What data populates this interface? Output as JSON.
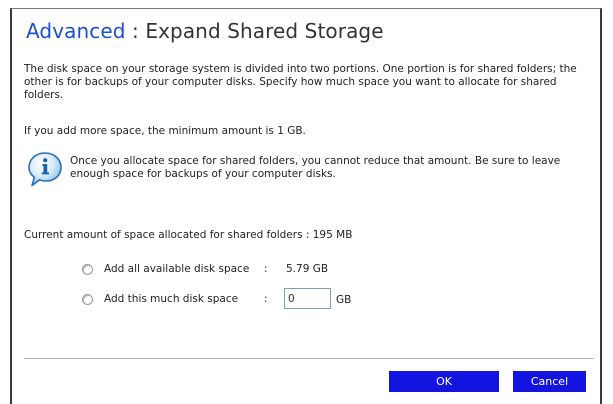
{
  "dialog": {
    "title_section": "Advanced",
    "title_separator": " : ",
    "title_page": "Expand Shared Storage",
    "intro_text": "The disk space on your storage system is divided into two portions. One portion is for shared folders; the other is for backups of your computer disks. Specify how much space you want to allocate for shared folders.",
    "minimum_text": "If you add more space, the minimum amount is 1 GB.",
    "info_icon": "info-speech-bubble-icon",
    "info_text": "Once you allocate space for shared folders, you cannot reduce that amount. Be sure to leave enough space for backups of your computer disks.",
    "current_text": "Current amount of space allocated for shared folders : 195 MB"
  },
  "options": {
    "add_all": {
      "label": "Add all available disk space",
      "separator": ":",
      "value": "5.79 GB",
      "selected": false
    },
    "add_custom": {
      "label": "Add this much disk space",
      "separator": ":",
      "input_value": "0",
      "unit": "GB",
      "selected": false
    }
  },
  "buttons": {
    "ok": "OK",
    "cancel": "Cancel"
  },
  "colors": {
    "title_accent": "#1a4fcf",
    "button_bg": "#1414e0",
    "button_text": "#ffffff"
  }
}
